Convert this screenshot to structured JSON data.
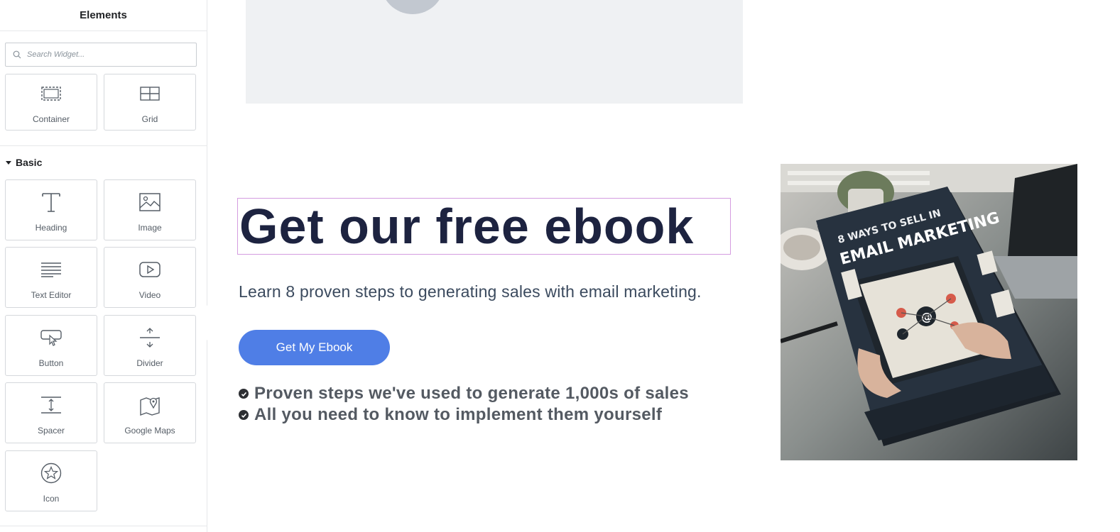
{
  "sidebar": {
    "title": "Elements",
    "search": {
      "placeholder": "Search Widget..."
    },
    "layout_widgets": [
      {
        "label": "Container",
        "icon": "container-icon"
      },
      {
        "label": "Grid",
        "icon": "grid-icon"
      }
    ],
    "category": "Basic",
    "basic_widgets": [
      {
        "label": "Heading",
        "icon": "heading-icon"
      },
      {
        "label": "Image",
        "icon": "image-icon"
      },
      {
        "label": "Text Editor",
        "icon": "text-editor-icon"
      },
      {
        "label": "Video",
        "icon": "video-icon"
      },
      {
        "label": "Button",
        "icon": "button-icon"
      },
      {
        "label": "Divider",
        "icon": "divider-icon"
      },
      {
        "label": "Spacer",
        "icon": "spacer-icon"
      },
      {
        "label": "Google Maps",
        "icon": "google-maps-icon"
      },
      {
        "label": "Icon",
        "icon": "star-icon"
      }
    ]
  },
  "canvas": {
    "heading": "Get our free ebook",
    "subtext": "Learn 8 proven steps to generating sales with email marketing.",
    "cta_label": "Get My Ebook",
    "bullets": [
      "Proven steps we've used to generate 1,000s of sales",
      "All you need to know to implement them yourself"
    ],
    "book": {
      "title_line1": "8 WAYS TO SELL IN",
      "title_line2": "EMAIL MARKETING"
    }
  },
  "colors": {
    "accent_button": "#4f7ee6",
    "heading": "#1d2340",
    "selection_outline": "#d49ce0"
  }
}
